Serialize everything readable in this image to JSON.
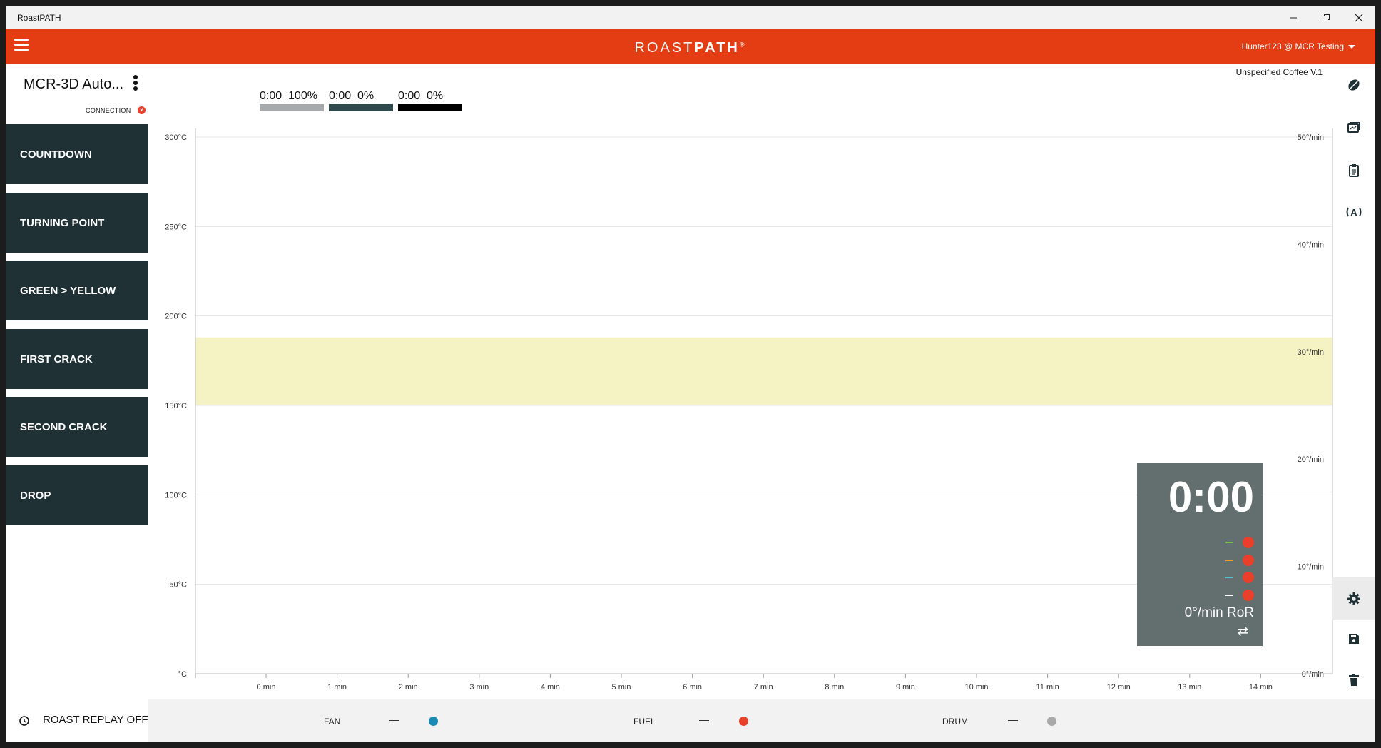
{
  "window": {
    "title": "RoastPATH"
  },
  "app": {
    "logo_left": "ROAST",
    "logo_right": "PATH",
    "logo_mark": "®",
    "user_menu": "Hunter123 @ MCR Testing"
  },
  "machine": {
    "name": "MCR-3D Auto...",
    "connection_label": "CONNECTION",
    "connection_status": "disconnected"
  },
  "events": [
    {
      "label": "COUNTDOWN"
    },
    {
      "label": "TURNING POINT"
    },
    {
      "label": "GREEN > YELLOW"
    },
    {
      "label": "FIRST CRACK"
    },
    {
      "label": "SECOND CRACK"
    },
    {
      "label": "DROP"
    }
  ],
  "legend": [
    {
      "time": "0:00",
      "value": "100%",
      "color": "#a6aaac"
    },
    {
      "time": "0:00",
      "value": "0%",
      "color": "#2e4a4d"
    },
    {
      "time": "0:00",
      "value": "0%",
      "color": "#000000"
    }
  ],
  "coffee_label": "Unspecified Coffee V.1",
  "chart_data": {
    "type": "line",
    "y_left_ticks": [
      "300°C",
      "250°C",
      "200°C",
      "150°C",
      "100°C",
      "50°C",
      "°C"
    ],
    "y_left_range": [
      0,
      300
    ],
    "y_right_ticks": [
      "50°/min",
      "40°/min",
      "30°/min",
      "20°/min",
      "10°/min",
      "0°/min"
    ],
    "y_right_range": [
      0,
      50
    ],
    "x_ticks": [
      "0 min",
      "1 min",
      "2 min",
      "3 min",
      "4 min",
      "5 min",
      "6 min",
      "7 min",
      "8 min",
      "9 min",
      "10 min",
      "11 min",
      "12 min",
      "13 min",
      "14 min"
    ],
    "band": {
      "from": 150,
      "to": 188,
      "color": "#f5f2c4"
    },
    "grid": true,
    "series": []
  },
  "overlay": {
    "time": "0:00",
    "probes": [
      {
        "dash_color": "#7ac143"
      },
      {
        "dash_color": "#f39c2c"
      },
      {
        "dash_color": "#4fc3d9"
      },
      {
        "dash_color": "#ffffff"
      }
    ],
    "ror": "0°/min RoR",
    "swap_icon": "swap-icon"
  },
  "right_rail": [
    {
      "icon": "bean-icon"
    },
    {
      "icon": "profile-icon"
    },
    {
      "icon": "clipboard-icon"
    },
    {
      "icon": "broadcast-icon"
    },
    {
      "icon": "gear-icon"
    },
    {
      "icon": "save-icon"
    },
    {
      "icon": "trash-icon"
    }
  ],
  "bottom": {
    "replay_label": "ROAST REPLAY OFF",
    "controls": [
      {
        "label": "FAN",
        "value": "—",
        "color": "#1b8ab5"
      },
      {
        "label": "FUEL",
        "value": "—",
        "color": "#e8402a"
      },
      {
        "label": "DRUM",
        "value": "—",
        "color": "#a9a9a9"
      }
    ]
  }
}
